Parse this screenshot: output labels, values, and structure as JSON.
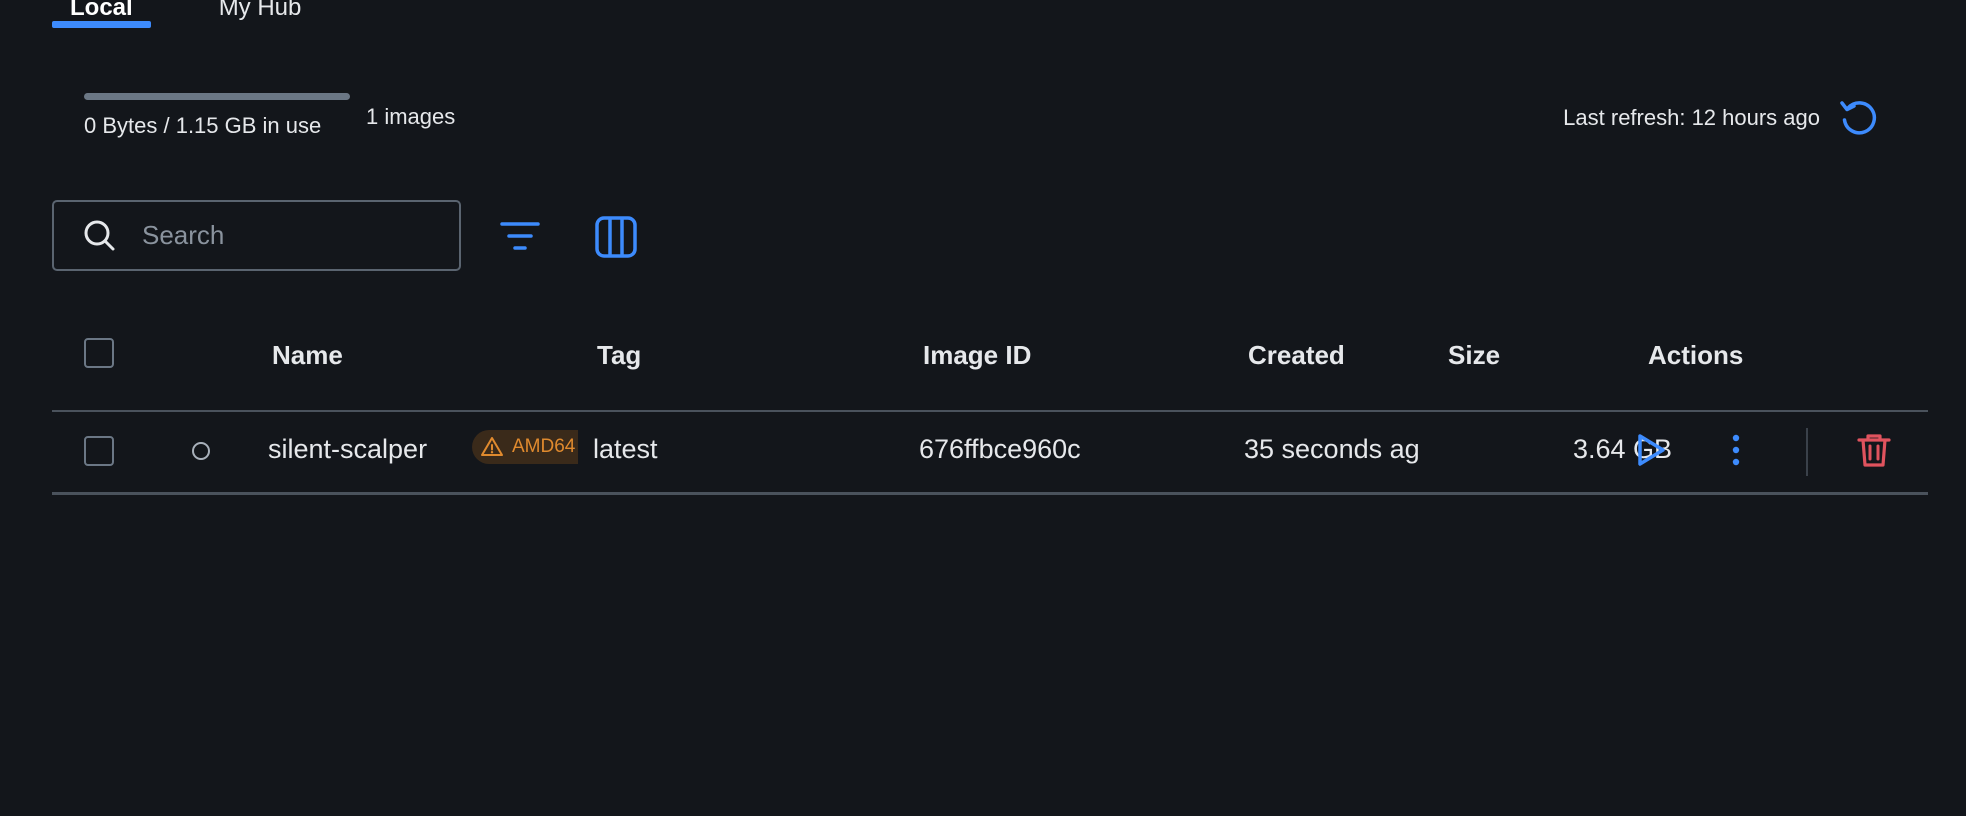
{
  "tabs": [
    {
      "label": "Local",
      "active": true
    },
    {
      "label": "My Hub",
      "active": false
    }
  ],
  "usage": {
    "text": "0 Bytes / 1.15 GB in use",
    "fraction_used": 0,
    "images_count": "1 images"
  },
  "refresh": {
    "text": "Last refresh: 12 hours ago",
    "icon": "refresh-icon"
  },
  "search": {
    "placeholder": "Search",
    "value": ""
  },
  "toolbar": {
    "filter_icon": "filter-icon",
    "columns_icon": "columns-icon"
  },
  "table": {
    "headers": {
      "name": "Name",
      "tag": "Tag",
      "image_id": "Image ID",
      "created": "Created",
      "size": "Size",
      "actions": "Actions"
    },
    "rows": [
      {
        "name": "silent-scalper",
        "badge": "AMD64",
        "tag": "latest",
        "image_id": "676ffbce960c",
        "created": "35 seconds ag",
        "size": "3.64 GB",
        "status": "unused"
      }
    ]
  },
  "colors": {
    "accent": "#3d8bfd",
    "danger": "#e0535e",
    "warning": "#e08a2e",
    "background": "#13161b"
  }
}
